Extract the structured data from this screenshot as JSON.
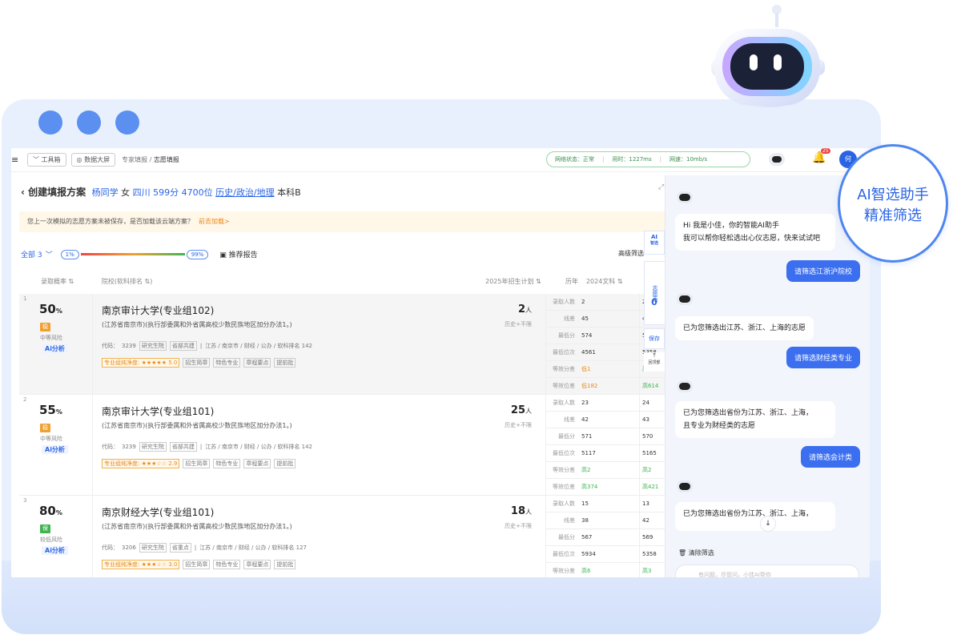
{
  "colors": {
    "accent": "#2a64e5",
    "bubble_user": "#3b6ff0",
    "warn": "#e88a1d",
    "risk_mid": "#f0a030",
    "risk_low": "#41b452"
  },
  "topbar": {
    "menu_icon": "≡",
    "toolbox": "工具箱",
    "bigscreen": "数据大屏",
    "crumb1": "专家填报",
    "crumb_sep": "/",
    "crumb2": "志愿填报",
    "status": {
      "net_label": "网络状态：正常",
      "time_label": "用时：1227ms",
      "speed_label": "网速：10mb/s"
    },
    "badge_count": "25",
    "avatar_text": "何"
  },
  "header": {
    "back": "‹",
    "title": "创建填报方案",
    "student": "杨同学",
    "gender": "女",
    "province": "四川",
    "score": "599分",
    "rank": "4700位",
    "subjects": "历史/政治/地理",
    "level": "本科B"
  },
  "notice": {
    "text": "您上一次模拟的志愿方案未被保存，是否加载该云端方案？",
    "link": "前去加载>"
  },
  "filter": {
    "all": "全部 3",
    "chevron": "﹀",
    "low": "1%",
    "high": "99%",
    "report": "推荐报告",
    "advanced": "高级筛选"
  },
  "table_headers": {
    "prob": "录取概率 ⇅",
    "school": "院校(软科排名 ⇅)",
    "plan": "2025年招生计划 ⇅",
    "history": "历年",
    "year": "2024文科 ⇅",
    "next": "20"
  },
  "rows": [
    {
      "num": "1",
      "prob": "50",
      "pct": "%",
      "risk": "稳",
      "risk_label": "中等风险",
      "ai": "Ai分析",
      "name": "南京审计大学(专业组102)",
      "desc": "(江苏省南京市)(执行部委属和外省属高校少数民族地区加分办法1。)",
      "code_label": "代码：",
      "code": "3239",
      "tags": [
        "研究生院",
        "省部共建"
      ],
      "loc": "江苏 / 南京市 / 财经 / 公办 / 软科排名 142",
      "star_label": "专业组纯净度:",
      "stars": "★★★★★ 5.0",
      "extra": [
        "招生简章",
        "特色专业",
        "章程要点",
        "提前批"
      ],
      "plan": "2",
      "unit": "人",
      "plan_sub": "历史+不限",
      "stats": [
        {
          "k": "录取人数",
          "v": "2",
          "v2": "2"
        },
        {
          "k": "线差",
          "v": "45",
          "v2": "42"
        },
        {
          "k": "最低分",
          "v": "574",
          "v2": "56"
        },
        {
          "k": "最低位次",
          "v": "4561",
          "v2": "5358"
        },
        {
          "k": "等效分差",
          "v": "低1",
          "v2": "高"
        },
        {
          "k": "等效位差",
          "v": "低182",
          "v2": "高614"
        }
      ]
    },
    {
      "num": "2",
      "prob": "55",
      "pct": "%",
      "risk": "稳",
      "risk_label": "中等风险",
      "ai": "Ai分析",
      "name": "南京审计大学(专业组101)",
      "desc": "(江苏省南京市)(执行部委属和外省属高校少数民族地区加分办法1。)",
      "code_label": "代码：",
      "code": "3239",
      "tags": [
        "研究生院",
        "省部共建"
      ],
      "loc": "江苏 / 南京市 / 财经 / 公办 / 软科排名 142",
      "star_label": "专业组纯净度:",
      "stars": "★★★☆☆ 2.9",
      "extra": [
        "招生简章",
        "特色专业",
        "章程要点",
        "提前批"
      ],
      "plan": "25",
      "unit": "人",
      "plan_sub": "历史+不限",
      "stats": [
        {
          "k": "录取人数",
          "v": "23",
          "v2": "24"
        },
        {
          "k": "线差",
          "v": "42",
          "v2": "43"
        },
        {
          "k": "最低分",
          "v": "571",
          "v2": "570"
        },
        {
          "k": "最低位次",
          "v": "5117",
          "v2": "5165"
        },
        {
          "k": "等效分差",
          "v": "高2",
          "v2": "高2"
        },
        {
          "k": "等效位差",
          "v": "高374",
          "v2": "高421"
        }
      ]
    },
    {
      "num": "3",
      "prob": "80",
      "pct": "%",
      "risk": "保",
      "risk_label": "较低风险",
      "ai": "Ai分析",
      "name": "南京财经大学(专业组101)",
      "desc": "(江苏省南京市)(执行部委属和外省属高校少数民族地区加分办法1。)",
      "code_label": "代码：",
      "code": "3206",
      "tags": [
        "研究生院",
        "省重点"
      ],
      "loc": "江苏 / 南京市 / 财经 / 公办 / 软科排名 127",
      "star_label": "专业组纯净度:",
      "stars": "★★★☆☆ 3.0",
      "extra": [
        "招生简章",
        "特色专业",
        "章程要点",
        "提前批"
      ],
      "plan": "18",
      "unit": "人",
      "plan_sub": "历史+不限",
      "stats": [
        {
          "k": "录取人数",
          "v": "15",
          "v2": "13"
        },
        {
          "k": "线差",
          "v": "38",
          "v2": "42"
        },
        {
          "k": "最低分",
          "v": "567",
          "v2": "569"
        },
        {
          "k": "最低位次",
          "v": "5934",
          "v2": "5358"
        },
        {
          "k": "等效分差",
          "v": "高6",
          "v2": "高3"
        }
      ]
    }
  ],
  "side_tabs": {
    "ai": "AI",
    "ai_sub": "智选",
    "wish": "志愿表",
    "count": "0",
    "save": "保存",
    "top": "⤒",
    "top_label": "回顶部"
  },
  "chat": {
    "greeting_line1": "Hi 我是小佳，你的智能AI助手",
    "greeting_line2": "我可以帮你轻松选出心仪志愿，快来试试吧",
    "user1": "请筛选江浙沪院校",
    "bot1": "已为您筛选出江苏、浙江、上海的志愿",
    "user2": "请筛选财经类专业",
    "bot2_l1": "已为您筛选出省份为江苏、浙江、上海，",
    "bot2_l2": "且专业为财经类的志愿",
    "user3": "请筛选会计类",
    "bot3": "已为您筛选出省份为江苏、浙江、上海，",
    "clear": "清除筛选",
    "input_placeholder": "有问题，尽管问，小佳AI帮你"
  },
  "callout": {
    "line1": "AI智选助手",
    "line2": "精准筛选"
  }
}
